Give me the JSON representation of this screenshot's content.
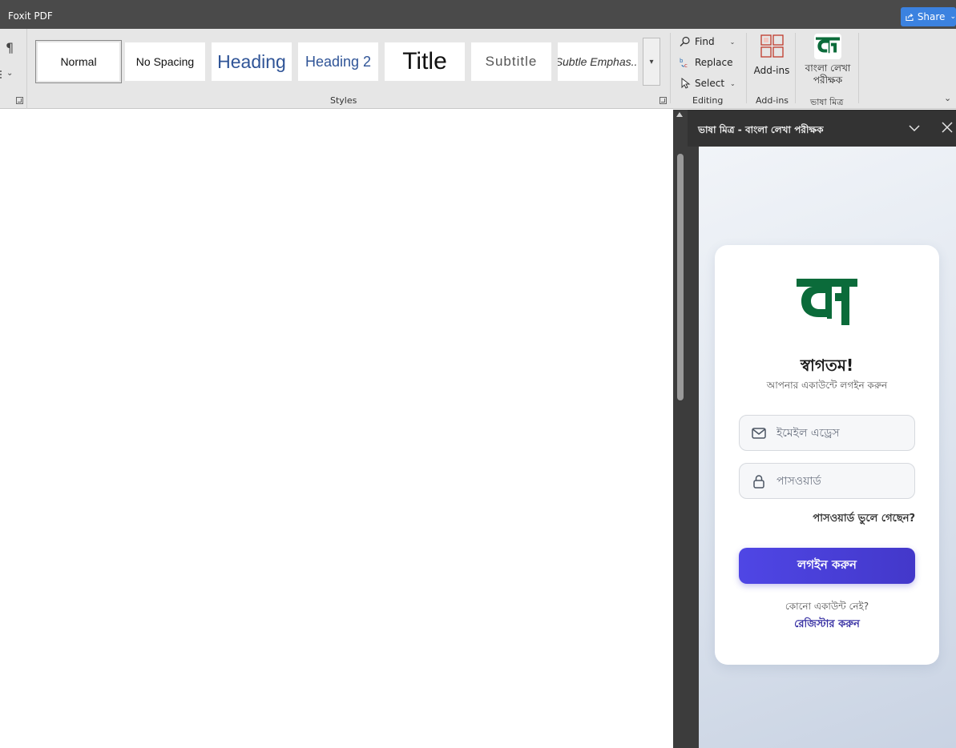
{
  "titlebar": {
    "title": "Foxit PDF",
    "share_label": "Share"
  },
  "ribbon": {
    "styles": [
      {
        "label": "Normal",
        "selected": true
      },
      {
        "label": "No Spacing"
      },
      {
        "label": "Heading"
      },
      {
        "label": "Heading 2"
      },
      {
        "label": "Title"
      },
      {
        "label": "Subtitle"
      },
      {
        "label": "Subtle Emphas..."
      }
    ],
    "styles_group_label": "Styles",
    "editing": {
      "find_label": "Find",
      "replace_label": "Replace",
      "select_label": "Select",
      "group_label": "Editing"
    },
    "addins": {
      "button_label": "Add-ins",
      "group_label": "Add-ins"
    },
    "bhasha_mitra": {
      "button_label_line1": "বাংলা লেখা",
      "button_label_line2": "পরীক্ষক",
      "group_label": "ভাষা মিত্র"
    }
  },
  "pane": {
    "title": "ভাষা মিত্র - বাংলা লেখা পরীক্ষক",
    "welcome": "স্বাগতম!",
    "subtitle": "আপনার একাউন্টে লগইন করুন",
    "email_placeholder": "ইমেইল এড্রেস",
    "password_placeholder": "পাসওয়ার্ড",
    "forgot_password": "পাসওয়ার্ড ভুলে গেছেন?",
    "login_button": "লগইন করুন",
    "no_account": "কোনো একাউন্ট নেই?",
    "register_link": "রেজিস্টার করুন"
  },
  "colors": {
    "brand_green": "#0b6b3a",
    "primary_button": "#4f46e5",
    "link": "#3730a3",
    "share_button": "#3b82e0"
  },
  "icons": [
    "pilcrow-icon",
    "find-icon",
    "replace-icon",
    "select-icon",
    "addins-icon",
    "bhasha-mitra-logo",
    "mail-icon",
    "lock-icon",
    "close-icon",
    "chevron-down-icon",
    "share-icon"
  ]
}
